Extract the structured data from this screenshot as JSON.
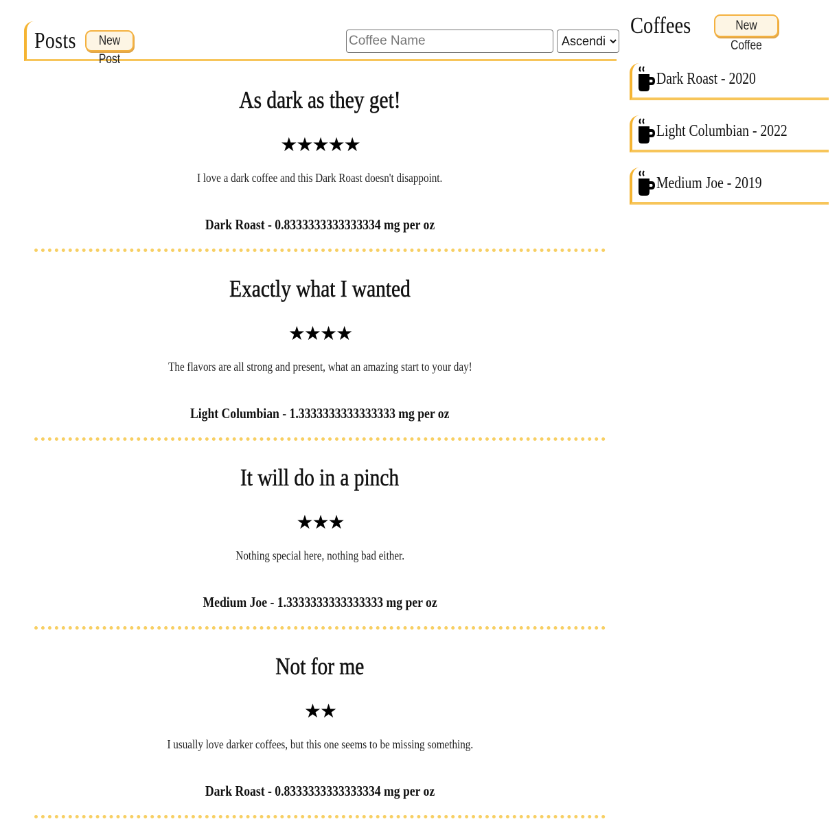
{
  "posts_header": {
    "title": "Posts",
    "new_post_label": "New Post",
    "search_placeholder": "Coffee Name",
    "sort_selected": "Ascending"
  },
  "posts": [
    {
      "title": "As dark as they get!",
      "rating": 5,
      "stars": "★★★★★",
      "body": "I love a dark coffee and this Dark Roast doesn't disappoint.",
      "meta": "Dark Roast - 0.8333333333333334 mg per oz"
    },
    {
      "title": "Exactly what I wanted",
      "rating": 4,
      "stars": "★★★★",
      "body": "The flavors are all strong and present, what an amazing start to your day!",
      "meta": "Light Columbian - 1.3333333333333333 mg per oz"
    },
    {
      "title": "It will do in a pinch",
      "rating": 3,
      "stars": "★★★",
      "body": "Nothing special here, nothing bad either.",
      "meta": "Medium Joe - 1.3333333333333333 mg per oz"
    },
    {
      "title": "Not for me",
      "rating": 2,
      "stars": "★★",
      "body": "I usually love darker coffees, but this one seems to be missing something.",
      "meta": "Dark Roast - 0.8333333333333334 mg per oz"
    }
  ],
  "coffees_panel": {
    "title": "Coffees",
    "new_coffee_label": "New Coffee",
    "items": [
      {
        "icon": "coffee-mug-icon",
        "label": "Dark Roast - 2020"
      },
      {
        "icon": "coffee-mug-icon",
        "label": "Light Columbian - 2022"
      },
      {
        "icon": "coffee-mug-icon",
        "label": "Medium Joe - 2019"
      }
    ]
  },
  "colors": {
    "accent": "#f5b432",
    "divider": "#f7cf63",
    "button_bg": "#fdf5e4"
  }
}
